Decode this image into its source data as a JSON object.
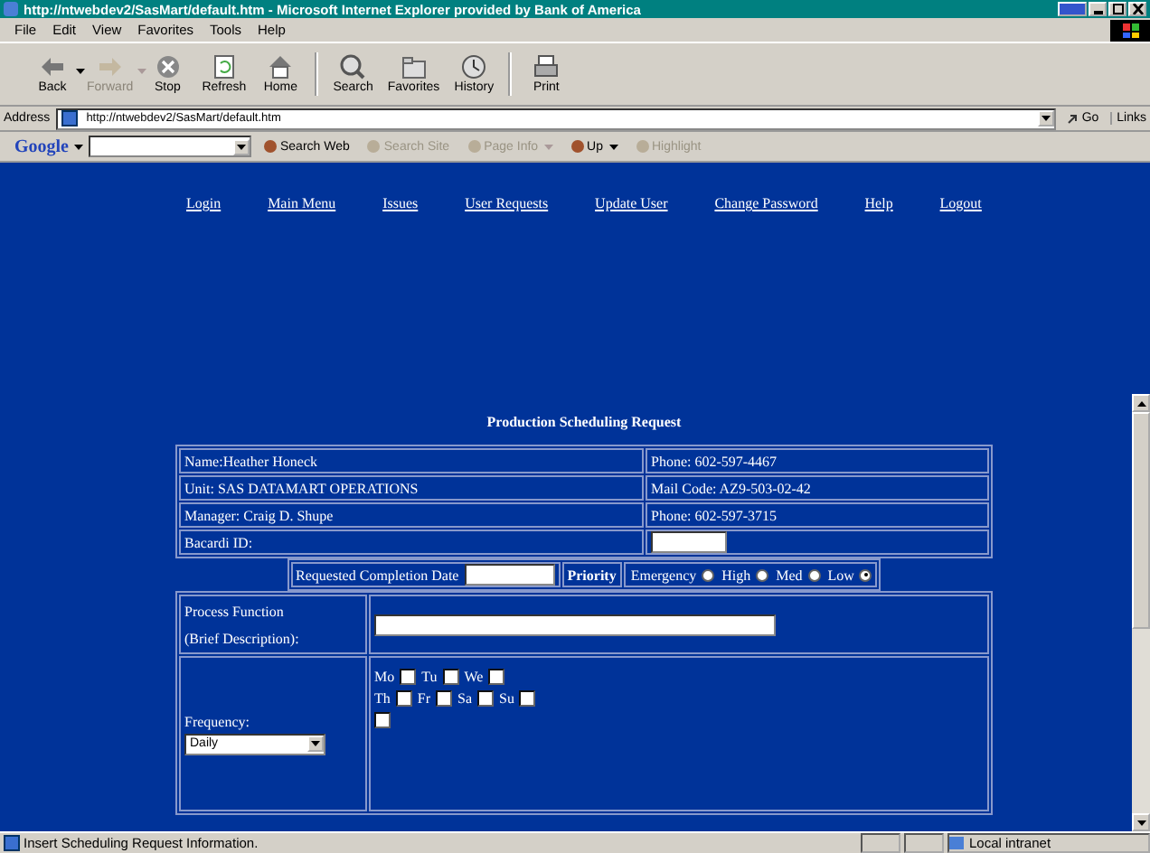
{
  "window": {
    "title": "http://ntwebdev2/SasMart/default.htm - Microsoft Internet Explorer provided by Bank of America"
  },
  "menu": [
    "File",
    "Edit",
    "View",
    "Favorites",
    "Tools",
    "Help"
  ],
  "toolbar": [
    {
      "label": "Back",
      "kind": "back",
      "disabled": false,
      "dropdown": true
    },
    {
      "label": "Forward",
      "kind": "forward",
      "disabled": true,
      "dropdown": true
    },
    {
      "label": "Stop",
      "kind": "stop",
      "disabled": false,
      "dropdown": false
    },
    {
      "label": "Refresh",
      "kind": "refresh",
      "disabled": false,
      "dropdown": false
    },
    {
      "label": "Home",
      "kind": "home",
      "disabled": false,
      "dropdown": false
    },
    {
      "label": "Search",
      "kind": "search",
      "disabled": false,
      "dropdown": false
    },
    {
      "label": "Favorites",
      "kind": "favorites",
      "disabled": false,
      "dropdown": false
    },
    {
      "label": "History",
      "kind": "history",
      "disabled": false,
      "dropdown": false
    },
    {
      "label": "Print",
      "kind": "print",
      "disabled": false,
      "dropdown": false
    }
  ],
  "address": {
    "label": "Address",
    "value": "http://ntwebdev2/SasMart/default.htm",
    "go": "Go",
    "links": "Links"
  },
  "google_bar": {
    "logo": "Google",
    "items": [
      {
        "label": "Search Web",
        "disabled": false,
        "dropdown": false
      },
      {
        "label": "Search Site",
        "disabled": true,
        "dropdown": false
      },
      {
        "label": "Page Info",
        "disabled": true,
        "dropdown": true
      },
      {
        "label": "Up",
        "disabled": false,
        "dropdown": true
      },
      {
        "label": "Highlight",
        "disabled": true,
        "dropdown": false
      }
    ]
  },
  "nav": [
    "Login",
    "Main Menu",
    "Issues",
    "User Requests",
    "Update User",
    "Change Password",
    "Help",
    "Logout"
  ],
  "form_title": "Production Scheduling Request",
  "info_rows": [
    {
      "left": "Name:Heather Honeck",
      "right": "Phone: 602-597-4467"
    },
    {
      "left": "Unit: SAS DATAMART OPERATIONS",
      "right": "Mail Code: AZ9-503-02-42"
    },
    {
      "left": "Manager: Craig D. Shupe",
      "right": "Phone: 602-597-3715"
    }
  ],
  "bacardi_label": "Bacardi ID:",
  "completion_label": "Requested Completion Date",
  "priority_label": "Priority",
  "priorities": [
    {
      "label": "Emergency",
      "selected": false
    },
    {
      "label": "High",
      "selected": false
    },
    {
      "label": "Med",
      "selected": false
    },
    {
      "label": "Low",
      "selected": true
    }
  ],
  "process_label": [
    "Process Function",
    "(Brief Description):"
  ],
  "frequency": {
    "label": "Frequency:",
    "value": "Daily"
  },
  "days": [
    [
      {
        "label": "Mo",
        "checked": false
      },
      {
        "label": "Tu",
        "checked": false
      },
      {
        "label": "We",
        "checked": false
      }
    ],
    [
      {
        "label": "Th",
        "checked": false
      },
      {
        "label": "Fr",
        "checked": false
      },
      {
        "label": "Sa",
        "checked": false
      },
      {
        "label": "Su",
        "checked": false
      }
    ]
  ],
  "extra_checkbox": {
    "checked": false
  },
  "status_bar": {
    "text": "Insert Scheduling Request Information.",
    "zone": "Local intranet"
  }
}
